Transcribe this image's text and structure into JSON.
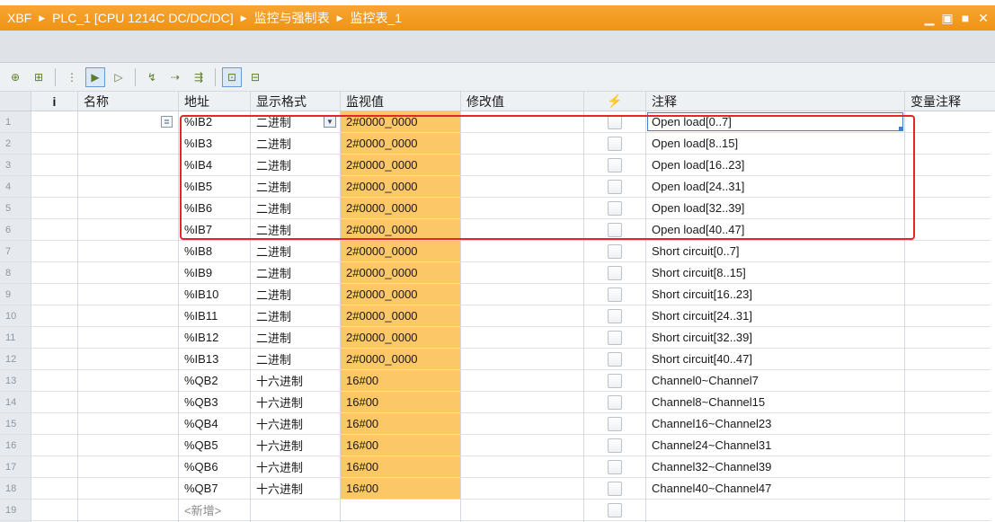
{
  "titlebar": {
    "project": "XBF",
    "device": "PLC_1 [CPU 1214C DC/DC/DC]",
    "folder": "监控与强制表",
    "table": "监控表_1",
    "minimize_icon": "minimize-icon",
    "restore_icon": "restore-icon",
    "maximize_icon": "maximize-icon",
    "close_icon": "close-icon",
    "accent": "#f29a1f"
  },
  "toolbar": {
    "buttons": [
      "insert-row-icon",
      "add-row-icon",
      "show-hide-columns-icon",
      "monitor-all-icon",
      "monitor-once-icon",
      "modify-now-icon",
      "modify-with-trigger-icon",
      "enable-peripheral-outputs-icon",
      "show-all-modify-icon",
      "show-force-icon"
    ]
  },
  "columns": {
    "num": "",
    "info": "i",
    "name": "名称",
    "address": "地址",
    "format": "显示格式",
    "monitor": "监视值",
    "modify": "修改值",
    "force": "⚡",
    "comment": "注释",
    "tag_comment": "变量注释"
  },
  "rows": [
    {
      "n": "1",
      "address": "%IB2",
      "format": "二进制",
      "monitor": "2#0000_0000",
      "comment": "Open load[0..7]"
    },
    {
      "n": "2",
      "address": "%IB3",
      "format": "二进制",
      "monitor": "2#0000_0000",
      "comment": "Open load[8..15]"
    },
    {
      "n": "3",
      "address": "%IB4",
      "format": "二进制",
      "monitor": "2#0000_0000",
      "comment": "Open load[16..23]"
    },
    {
      "n": "4",
      "address": "%IB5",
      "format": "二进制",
      "monitor": "2#0000_0000",
      "comment": "Open load[24..31]"
    },
    {
      "n": "5",
      "address": "%IB6",
      "format": "二进制",
      "monitor": "2#0000_0000",
      "comment": "Open load[32..39]"
    },
    {
      "n": "6",
      "address": "%IB7",
      "format": "二进制",
      "monitor": "2#0000_0000",
      "comment": "Open load[40..47]"
    },
    {
      "n": "7",
      "address": "%IB8",
      "format": "二进制",
      "monitor": "2#0000_0000",
      "comment": "Short circuit[0..7]"
    },
    {
      "n": "8",
      "address": "%IB9",
      "format": "二进制",
      "monitor": "2#0000_0000",
      "comment": "Short circuit[8..15]"
    },
    {
      "n": "9",
      "address": "%IB10",
      "format": "二进制",
      "monitor": "2#0000_0000",
      "comment": "Short circuit[16..23]"
    },
    {
      "n": "10",
      "address": "%IB11",
      "format": "二进制",
      "monitor": "2#0000_0000",
      "comment": "Short circuit[24..31]"
    },
    {
      "n": "11",
      "address": "%IB12",
      "format": "二进制",
      "monitor": "2#0000_0000",
      "comment": "Short circuit[32..39]"
    },
    {
      "n": "12",
      "address": "%IB13",
      "format": "二进制",
      "monitor": "2#0000_0000",
      "comment": "Short circuit[40..47]"
    },
    {
      "n": "13",
      "address": "%QB2",
      "format": "十六进制",
      "monitor": "16#00",
      "comment": "Channel0~Channel7"
    },
    {
      "n": "14",
      "address": "%QB3",
      "format": "十六进制",
      "monitor": "16#00",
      "comment": "Channel8~Channel15"
    },
    {
      "n": "15",
      "address": "%QB4",
      "format": "十六进制",
      "monitor": "16#00",
      "comment": "Channel16~Channel23"
    },
    {
      "n": "16",
      "address": "%QB5",
      "format": "十六进制",
      "monitor": "16#00",
      "comment": "Channel24~Channel31"
    },
    {
      "n": "17",
      "address": "%QB6",
      "format": "十六进制",
      "monitor": "16#00",
      "comment": "Channel32~Channel39"
    },
    {
      "n": "18",
      "address": "%QB7",
      "format": "十六进制",
      "monitor": "16#00",
      "comment": "Channel40~Channel47"
    },
    {
      "n": "19",
      "address": "<新增>",
      "format": "",
      "monitor": "",
      "comment": ""
    }
  ],
  "colors": {
    "monitor_highlight": "#fcc767",
    "selection_box": "#e3262b"
  }
}
